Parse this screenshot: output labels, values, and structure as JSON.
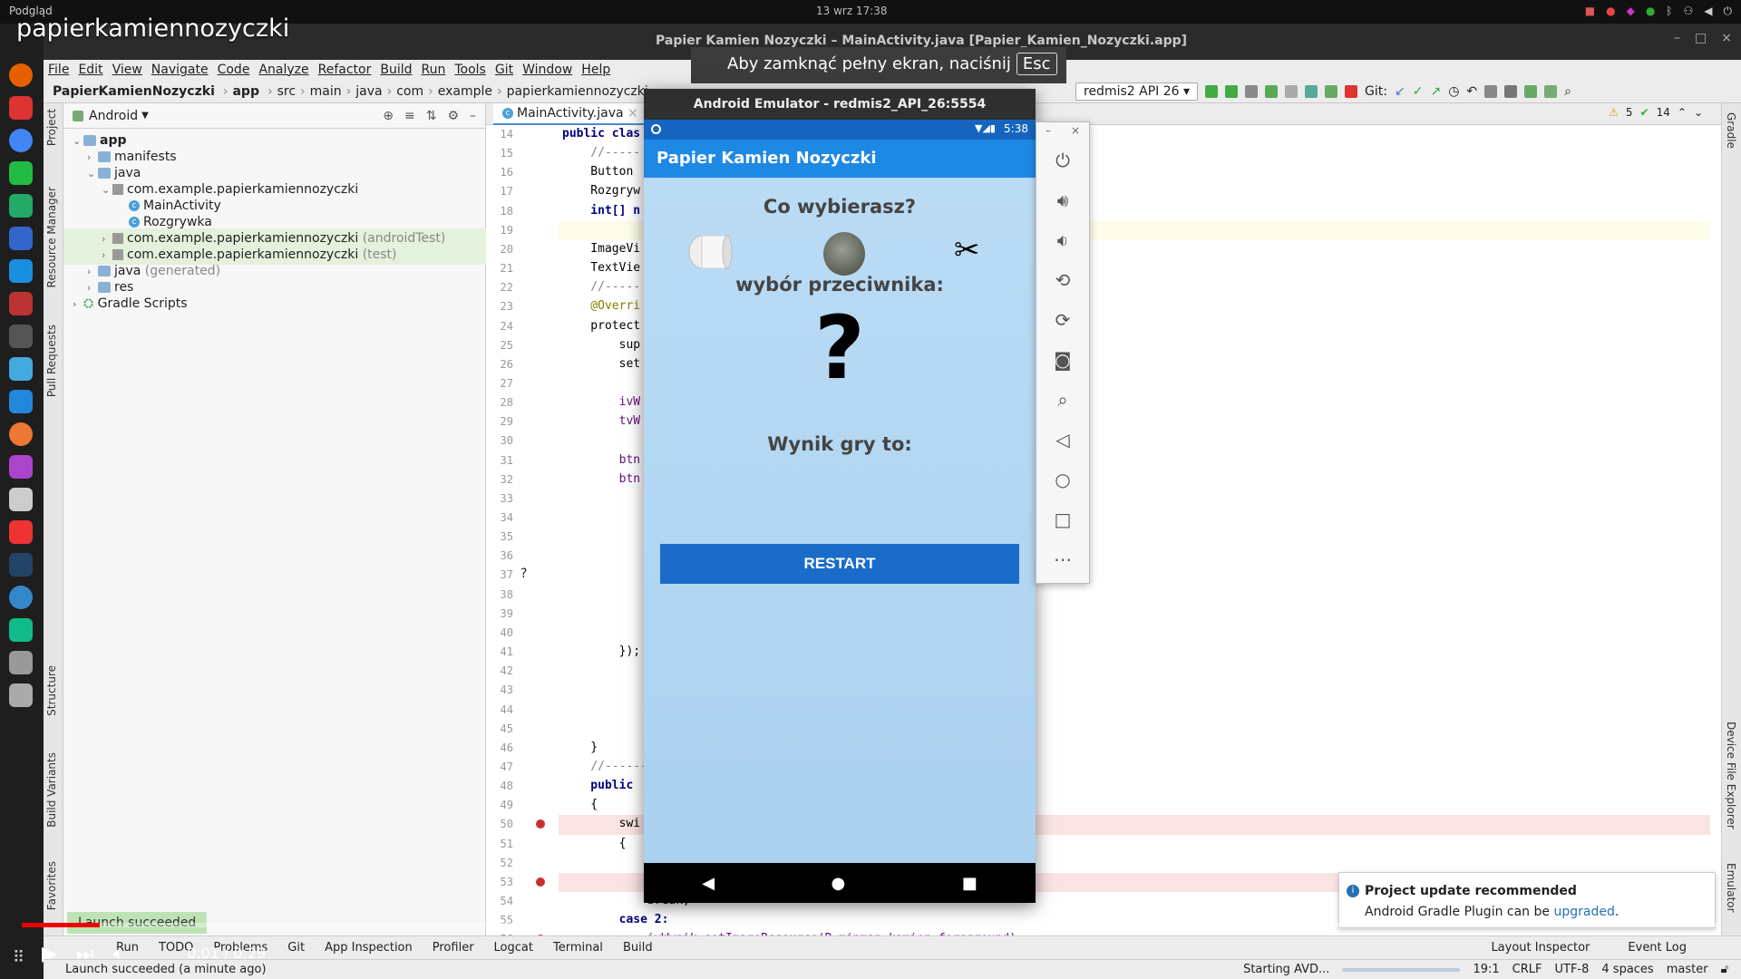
{
  "system": {
    "app_label": "Podgląd",
    "datetime": "13 wrz 17:38"
  },
  "video": {
    "title": "papierkamiennozyczki",
    "time": "0:01 / 0:29",
    "progress": 0.046
  },
  "window": {
    "title": "Papier Kamien Nozyczki – MainActivity.java [Papier_Kamien_Nozyczki.app]"
  },
  "fullscreen_hint": {
    "text": "Aby zamknąć pełny ekran, naciśnij",
    "key": "Esc"
  },
  "menu": [
    "File",
    "Edit",
    "View",
    "Navigate",
    "Code",
    "Analyze",
    "Refactor",
    "Build",
    "Run",
    "Tools",
    "Git",
    "Window",
    "Help"
  ],
  "breadcrumb": [
    "PapierKamienNozyczki",
    "app",
    "src",
    "main",
    "java",
    "com",
    "example",
    "papierkamiennozyczki"
  ],
  "toolbar": {
    "device": "redmis2 API 26",
    "git_label": "Git:"
  },
  "project_panel": {
    "view": "Android",
    "tree": [
      {
        "label": "app",
        "kind": "folder"
      },
      {
        "label": "manifests",
        "kind": "folder"
      },
      {
        "label": "java",
        "kind": "folder"
      },
      {
        "label": "com.example.papierkamiennozyczki",
        "kind": "package"
      },
      {
        "label": "MainActivity",
        "kind": "class"
      },
      {
        "label": "Rozgrywka",
        "kind": "class"
      },
      {
        "label": "com.example.papierkamiennozyczki",
        "suffix": "(androidTest)",
        "kind": "package"
      },
      {
        "label": "com.example.papierkamiennozyczki",
        "suffix": "(test)",
        "kind": "package"
      },
      {
        "label": "java",
        "suffix": "(generated)",
        "kind": "folder"
      },
      {
        "label": "res",
        "kind": "folder"
      },
      {
        "label": "Gradle Scripts",
        "kind": "gradle"
      }
    ]
  },
  "left_tabs": [
    "Project",
    "Resource Manager",
    "Pull Requests",
    "Structure",
    "Build Variants",
    "Favorites"
  ],
  "right_tabs": [
    "Gradle",
    "Device File Explorer",
    "Emulator"
  ],
  "editor": {
    "tab": "MainActivity.java",
    "inspections": {
      "warnings": "5",
      "ok": "14"
    },
    "lines": [
      {
        "n": "14",
        "text": "public clas"
      },
      {
        "n": "15",
        "text": "    //-----"
      },
      {
        "n": "16",
        "text": "    Button "
      },
      {
        "n": "17",
        "text": "    Rozgryw"
      },
      {
        "n": "18",
        "text": "    int[] n"
      },
      {
        "n": "19",
        "text": ""
      },
      {
        "n": "20",
        "text": "    ImageVi"
      },
      {
        "n": "21",
        "text": "    TextVie"
      },
      {
        "n": "22",
        "text": "    //-----"
      },
      {
        "n": "23",
        "text": "    @Overri"
      },
      {
        "n": "24",
        "text": "    protect"
      },
      {
        "n": "25",
        "text": "        sup"
      },
      {
        "n": "26",
        "text": "        set"
      },
      {
        "n": "27",
        "text": ""
      },
      {
        "n": "28",
        "text": "        ivW"
      },
      {
        "n": "29",
        "text": "        tvW"
      },
      {
        "n": "30",
        "text": ""
      },
      {
        "n": "31",
        "text": "        btn"
      },
      {
        "n": "32",
        "text": "        btn"
      },
      {
        "n": "33",
        "text": ""
      },
      {
        "n": "34",
        "text": ""
      },
      {
        "n": "35",
        "text": ""
      },
      {
        "n": "36",
        "text": ""
      },
      {
        "n": "37",
        "text": ""
      },
      {
        "n": "38",
        "text": ""
      },
      {
        "n": "39",
        "text": ""
      },
      {
        "n": "40",
        "text": ""
      },
      {
        "n": "41",
        "text": "        });"
      },
      {
        "n": "42",
        "text": ""
      },
      {
        "n": "43",
        "text": ""
      },
      {
        "n": "44",
        "text": ""
      },
      {
        "n": "45",
        "text": ""
      },
      {
        "n": "46",
        "text": "    }"
      },
      {
        "n": "47",
        "text": "    //------------------------------------------------------------"
      },
      {
        "n": "48",
        "text": "    public "
      },
      {
        "n": "49",
        "text": "    {"
      },
      {
        "n": "50",
        "text": "        swi"
      },
      {
        "n": "51",
        "text": "        {"
      },
      {
        "n": "52",
        "text": ""
      },
      {
        "n": "53",
        "text": ""
      },
      {
        "n": "54",
        "text": "            break;"
      },
      {
        "n": "55",
        "text": "        case 2:"
      },
      {
        "n": "56",
        "text": "            ivWynik.setImageResource(R.mipmap.kamien_foreground);"
      }
    ],
    "gutter_question": "?"
  },
  "emulator": {
    "title": "Android Emulator - redmis2_API_26:5554",
    "time": "5:38",
    "app_title": "Papier Kamien Nozyczki",
    "prompt": "Co wybierasz?",
    "opponent_label": "wybór przeciwnika:",
    "opponent_choice": "?",
    "result_label": "Wynik gry to:",
    "restart": "RESTART",
    "choices": [
      "paper-icon",
      "rock-icon",
      "scissors-icon"
    ],
    "scissors_glyph": "✂"
  },
  "notification": {
    "title": "Project update recommended",
    "body": "Android Gradle Plugin can be",
    "link": "upgraded",
    "end": "."
  },
  "toolwindows": [
    "Run",
    "TODO",
    "Problems",
    "Git",
    "App Inspection",
    "Profiler",
    "Logcat",
    "Terminal",
    "Build"
  ],
  "launch_tip": "Launch succeeded",
  "status": {
    "message": "Launch succeeded (a minute ago)",
    "task": "Starting AVD...",
    "position": "19:1",
    "line_sep": "CRLF",
    "encoding": "UTF-8",
    "indent": "4 spaces",
    "branch": "master",
    "event_log": "Event Log",
    "layout_inspector": "Layout Inspector"
  }
}
